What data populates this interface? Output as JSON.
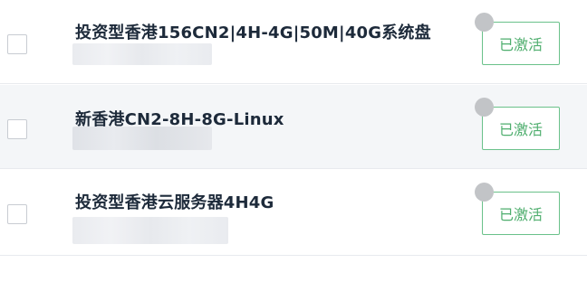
{
  "items": [
    {
      "title": "投资型香港156CN2|4H-4G|50M|40G系统盘",
      "status": "已激活"
    },
    {
      "title": "新香港CN2-8H-8G-Linux",
      "status": "已激活"
    },
    {
      "title": "投资型香港云服务器4H4G",
      "status": "已激活"
    }
  ],
  "colors": {
    "status_green": "#4fae6e",
    "title_text": "#1d2a3a",
    "dot_gray": "#c2c4c7"
  }
}
